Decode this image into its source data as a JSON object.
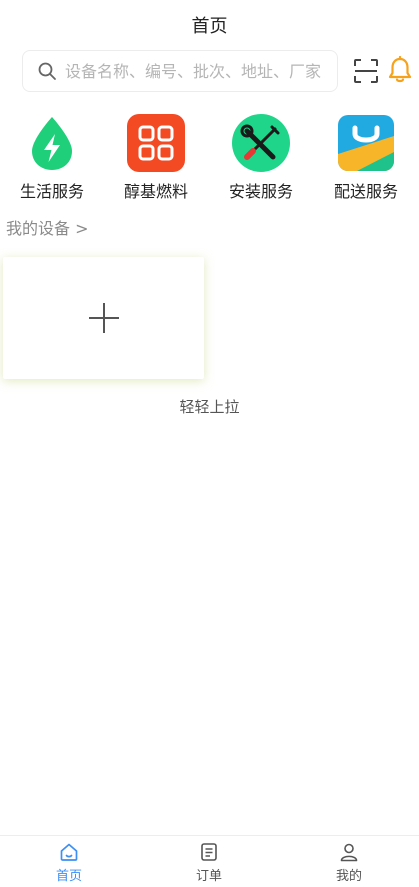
{
  "header": {
    "title": "首页"
  },
  "search": {
    "placeholder": "设备名称、编号、批次、地址、厂家"
  },
  "services": [
    {
      "label": "生活服务",
      "icon": "water-drop-lightning-icon",
      "color": "#1fcf7a"
    },
    {
      "label": "醇基燃料",
      "icon": "grid-squares-icon",
      "color": "#f34a24"
    },
    {
      "label": "安装服务",
      "icon": "wrench-screwdriver-icon",
      "color": "#1fd58a"
    },
    {
      "label": "配送服务",
      "icon": "shopping-bag-icon",
      "color": "#21a9e1"
    }
  ],
  "devices": {
    "title": "我的设备 >"
  },
  "pull_hint": "轻轻上拉",
  "tabs": [
    {
      "label": "首页",
      "icon": "home-icon",
      "active": true
    },
    {
      "label": "订单",
      "icon": "order-list-icon",
      "active": false
    },
    {
      "label": "我的",
      "icon": "user-icon",
      "active": false
    }
  ],
  "colors": {
    "accent": "#3b8ff5",
    "bell": "#f7a21b"
  }
}
